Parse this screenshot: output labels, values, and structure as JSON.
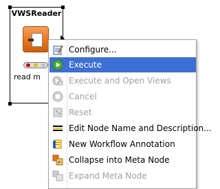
{
  "node": {
    "title": "VWSReader",
    "label": "read m",
    "status_colors": [
      "#c00000",
      "#e0c000",
      "#c0c0c0"
    ]
  },
  "menu": {
    "items": [
      {
        "label": "Configure...",
        "icon": "configure-icon",
        "enabled": true,
        "highlighted": false
      },
      {
        "label": "Execute",
        "icon": "execute-icon",
        "enabled": true,
        "highlighted": true
      },
      {
        "label": "Execute and Open Views",
        "icon": "execute-open-views-icon",
        "enabled": false,
        "highlighted": false
      },
      {
        "label": "Cancel",
        "icon": "cancel-icon",
        "enabled": false,
        "highlighted": false
      },
      {
        "label": "Reset",
        "icon": "reset-icon",
        "enabled": false,
        "highlighted": false
      },
      {
        "label": "Edit Node Name and Description...",
        "icon": "edit-name-icon",
        "enabled": true,
        "highlighted": false
      },
      {
        "label": "New Workflow Annotation",
        "icon": "annotation-icon",
        "enabled": true,
        "highlighted": false
      },
      {
        "label": "Collapse into Meta Node",
        "icon": "collapse-meta-node-icon",
        "enabled": true,
        "highlighted": false
      },
      {
        "label": "Expand Meta Node",
        "icon": "expand-meta-node-icon",
        "enabled": false,
        "highlighted": false
      }
    ],
    "highlight_color": "#3e6fd2",
    "disabled_color": "#a0a0a0"
  }
}
